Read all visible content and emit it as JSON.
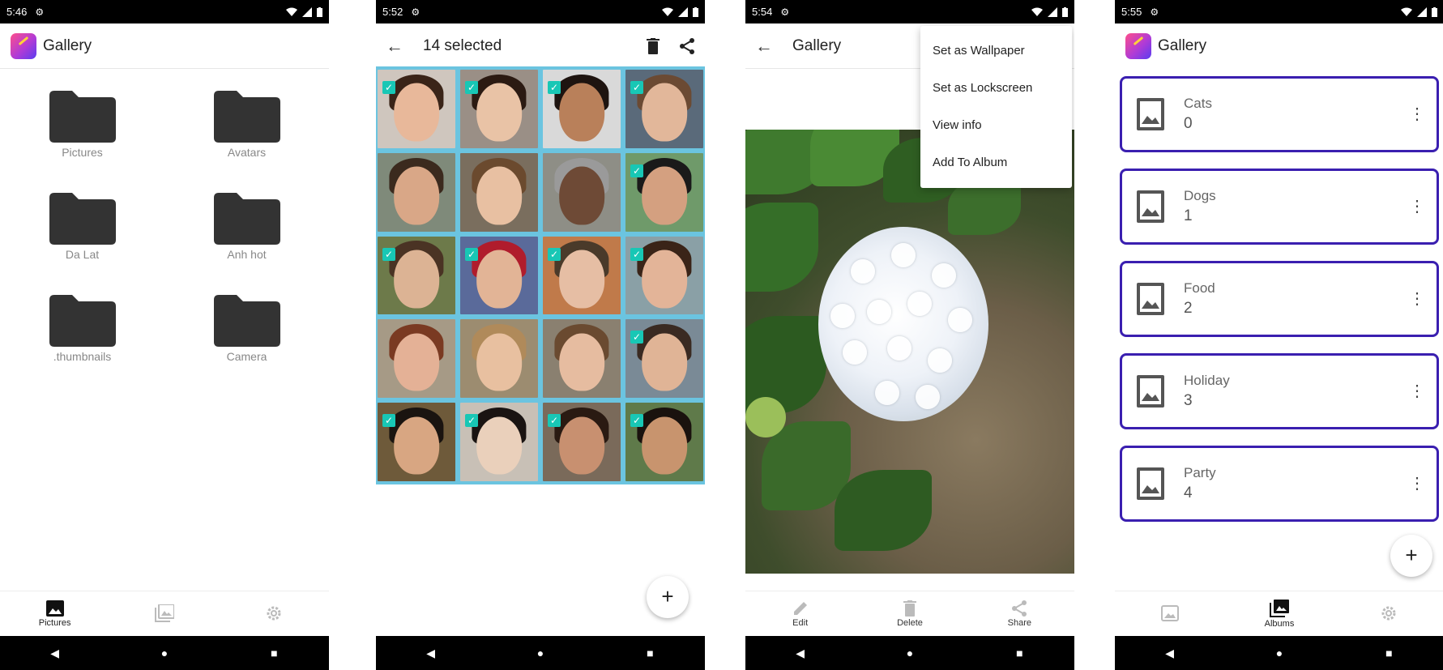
{
  "screen1": {
    "time": "5:46",
    "app_title": "Gallery",
    "folders": [
      {
        "label": "Pictures"
      },
      {
        "label": "Avatars"
      },
      {
        "label": "Da Lat"
      },
      {
        "label": "Anh hot"
      },
      {
        "label": ".thumbnails"
      },
      {
        "label": "Camera"
      }
    ],
    "bottom_nav": {
      "pictures_label": "Pictures",
      "active": "pictures"
    }
  },
  "screen2": {
    "time": "5:52",
    "title": "14 selected",
    "grid": [
      {
        "selected": true,
        "skin": "#e8b89a",
        "hair": "#3a2418",
        "bg": "#cfc6be"
      },
      {
        "selected": true,
        "skin": "#e9c3a6",
        "hair": "#2b1a12",
        "bg": "#9a8f86"
      },
      {
        "selected": true,
        "skin": "#b9805a",
        "hair": "#1e1410",
        "bg": "#d9d9d9"
      },
      {
        "selected": true,
        "skin": "#e2b79a",
        "hair": "#6b4a33",
        "bg": "#5a6a7a"
      },
      {
        "selected": false,
        "skin": "#d9a787",
        "hair": "#3b2a1e",
        "bg": "#7f8a7a"
      },
      {
        "selected": false,
        "skin": "#e8c0a2",
        "hair": "#6b4a2e",
        "bg": "#7a6e5e"
      },
      {
        "selected": false,
        "skin": "#6e4a36",
        "hair": "#9a9a9a",
        "bg": "#8e8e86"
      },
      {
        "selected": true,
        "skin": "#d4a080",
        "hair": "#1a1a1a",
        "bg": "#6f9a6a"
      },
      {
        "selected": true,
        "skin": "#dcb394",
        "hair": "#4a3324",
        "bg": "#6d7a4a"
      },
      {
        "selected": true,
        "skin": "#e2b496",
        "hair": "#b01c2c",
        "bg": "#5a6a9a"
      },
      {
        "selected": true,
        "skin": "#e6bea4",
        "hair": "#4a3a2a",
        "bg": "#c07a4a"
      },
      {
        "selected": true,
        "skin": "#e3b498",
        "hair": "#3a2418",
        "bg": "#8aa0a6"
      },
      {
        "selected": false,
        "skin": "#e4b196",
        "hair": "#7a3a22",
        "bg": "#a69a86"
      },
      {
        "selected": false,
        "skin": "#e8c0a0",
        "hair": "#b08a5a",
        "bg": "#9c8c70"
      },
      {
        "selected": false,
        "skin": "#e6bca0",
        "hair": "#6a4a30",
        "bg": "#8a8070"
      },
      {
        "selected": true,
        "skin": "#e0b496",
        "hair": "#3a2a22",
        "bg": "#7a8a96"
      },
      {
        "selected": true,
        "skin": "#d8a682",
        "hair": "#1a1410",
        "bg": "#6e5a3a"
      },
      {
        "selected": true,
        "skin": "#ead0bb",
        "hair": "#1a1412",
        "bg": "#c8c0b6"
      },
      {
        "selected": true,
        "skin": "#c89070",
        "hair": "#2a1a12",
        "bg": "#7a6a5a"
      },
      {
        "selected": true,
        "skin": "#c8946e",
        "hair": "#1a120e",
        "bg": "#5f7a4a"
      }
    ],
    "fab_label": "+"
  },
  "screen3": {
    "time": "5:54",
    "title": "Gallery",
    "menu_items": [
      {
        "label": "Set as Wallpaper"
      },
      {
        "label": "Set as Lockscreen"
      },
      {
        "label": "View info"
      },
      {
        "label": "Add To Album"
      }
    ],
    "actions": [
      {
        "label": "Edit",
        "icon": "pencil-icon"
      },
      {
        "label": "Delete",
        "icon": "trash-icon"
      },
      {
        "label": "Share",
        "icon": "share-icon"
      }
    ]
  },
  "screen4": {
    "time": "5:55",
    "app_title": "Gallery",
    "albums": [
      {
        "name": "Cats",
        "count": "0"
      },
      {
        "name": "Dogs",
        "count": "1"
      },
      {
        "name": "Food",
        "count": "2"
      },
      {
        "name": "Holiday",
        "count": "3"
      },
      {
        "name": "Party",
        "count": "4"
      }
    ],
    "fab_label": "+",
    "bottom_nav": {
      "albums_label": "Albums",
      "active": "albums"
    }
  },
  "colors": {
    "album_border": "#3a1fb0",
    "selection_frame": "#6bc4e0",
    "check": "#18c7b5"
  }
}
